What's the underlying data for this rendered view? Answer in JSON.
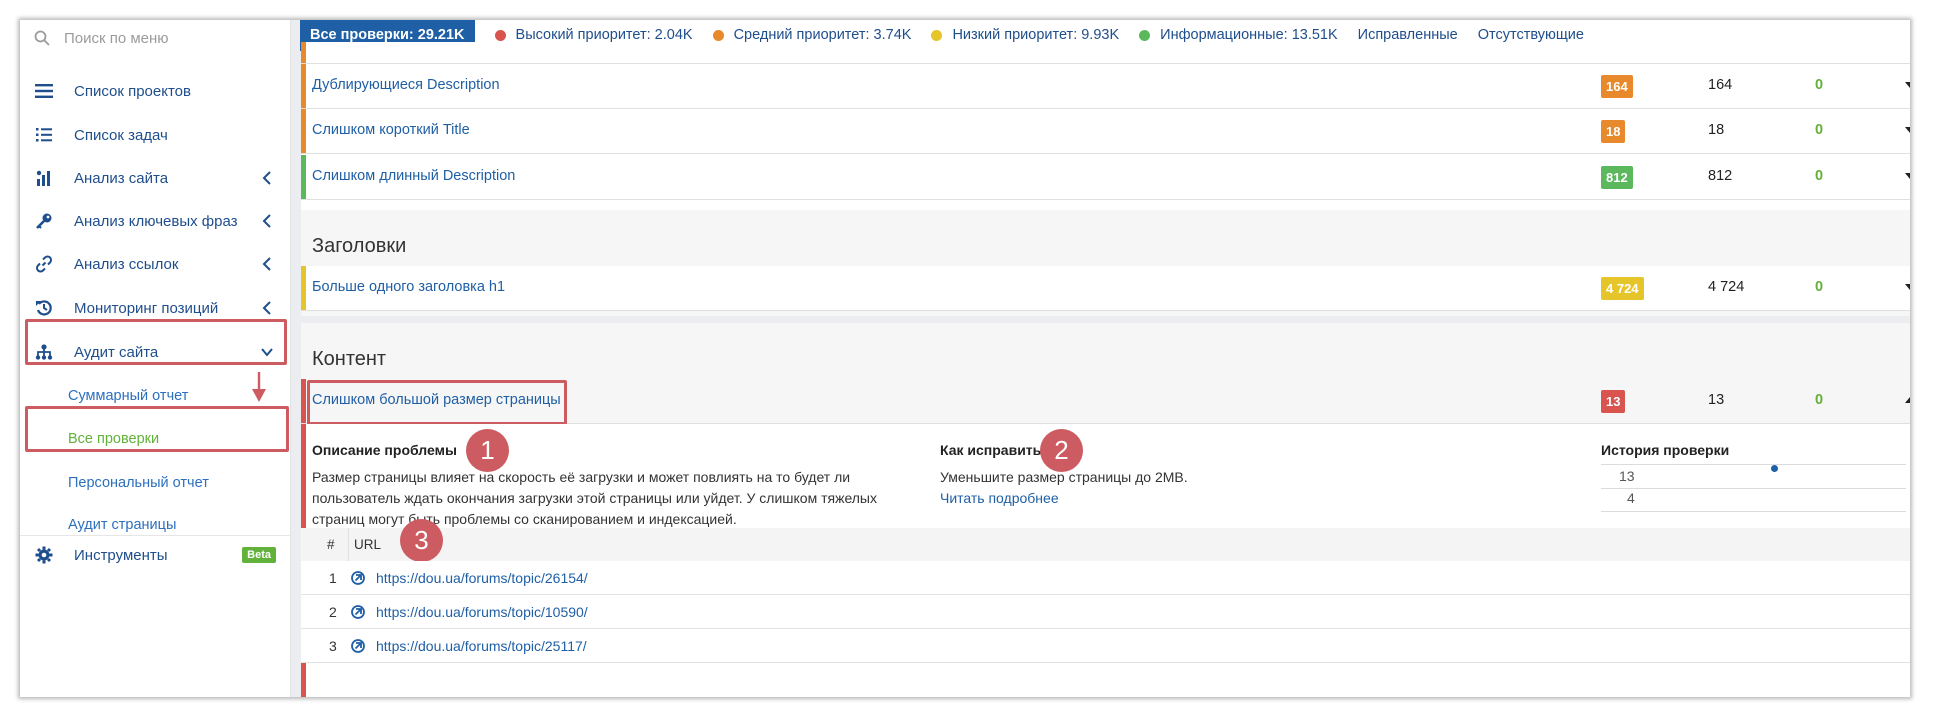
{
  "sidebar": {
    "search_placeholder": "Поиск по меню",
    "items": [
      {
        "label": "Список проектов"
      },
      {
        "label": "Список задач"
      },
      {
        "label": "Анализ сайта"
      },
      {
        "label": "Анализ ключевых фраз"
      },
      {
        "label": "Анализ ссылок"
      },
      {
        "label": "Мониторинг позиций"
      },
      {
        "label": "Аудит сайта"
      }
    ],
    "sub_items": [
      {
        "label": "Суммарный отчет"
      },
      {
        "label": "Все проверки"
      },
      {
        "label": "Персональный отчет"
      },
      {
        "label": "Аудит страницы"
      }
    ],
    "tools_label": "Инструменты",
    "beta_label": "Beta"
  },
  "topbar": {
    "all_checks": "Все проверки: 29.21K",
    "high": "Высокий приоритет: 2.04K",
    "medium": "Средний приоритет: 3.74K",
    "low": "Низкий приоритет: 9.93K",
    "info": "Информационные: 13.51K",
    "fixed": "Исправленные",
    "missing": "Отсутствующие"
  },
  "colors": {
    "high": "#d9534f",
    "medium": "#e8892b",
    "low": "#e6c52b",
    "info": "#5cb85c",
    "brand": "#1f5fa5",
    "annotation": "#cd5c62"
  },
  "meta_rows": [
    {
      "title": "Дублирующиеся Description",
      "badge": "164",
      "count": "164",
      "fixed": "0"
    },
    {
      "title": "Слишком короткий Title",
      "badge": "18",
      "count": "18",
      "fixed": "0"
    },
    {
      "title": "Слишком длинный Description",
      "badge": "812",
      "count": "812",
      "fixed": "0"
    }
  ],
  "headings": {
    "title": "Заголовки",
    "row": {
      "title": "Больше одного заголовка h1",
      "badge": "4 724",
      "count": "4 724",
      "fixed": "0"
    }
  },
  "content": {
    "title": "Контент",
    "row": {
      "title": "Слишком большой размер страницы",
      "badge": "13",
      "count": "13",
      "fixed": "0"
    },
    "description_label": "Описание проблемы",
    "description_text": "Размер страницы влияет на скорость её загрузки и может повлиять на то будет ли пользователь ждать окончания загрузки этой страницы или уйдет. У слишком тяжелых страниц могут быть проблемы со сканированием и индексацией.",
    "fix_label": "Как исправить?",
    "fix_text": "Уменьшите размер страницы до 2MB.",
    "read_more": "Читать подробнее",
    "history_label": "История проверки",
    "history_ticks": [
      "13",
      "4"
    ],
    "history_points": [
      {
        "x": 0,
        "y": 13
      }
    ],
    "url_col_index": "#",
    "url_col_url": "URL",
    "urls": [
      {
        "idx": "1",
        "url": "https://dou.ua/forums/topic/26154/"
      },
      {
        "idx": "2",
        "url": "https://dou.ua/forums/topic/10590/"
      },
      {
        "idx": "3",
        "url": "https://dou.ua/forums/topic/25117/"
      }
    ]
  },
  "annotations": [
    "1",
    "2",
    "3"
  ]
}
